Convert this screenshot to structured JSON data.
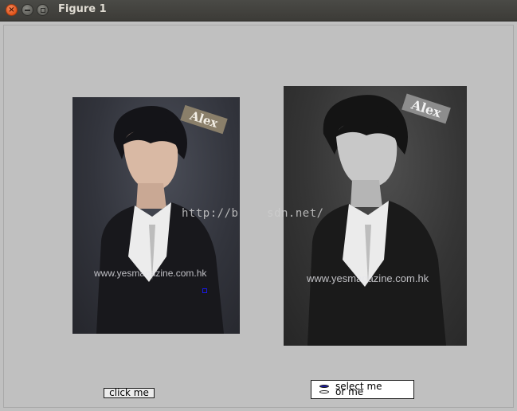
{
  "window": {
    "title": "Figure 1"
  },
  "images": {
    "left": {
      "name_tag": "Alex",
      "watermark": "www.yesmagazine.com.hk"
    },
    "right": {
      "name_tag": "Alex",
      "watermark": "www.yesmagazine.com.hk"
    }
  },
  "overlay_watermark": "http://b    sdn.net/",
  "controls": {
    "button_label": "click me",
    "radio_options": [
      {
        "label": "select me",
        "selected": true
      },
      {
        "label": "or me",
        "selected": false
      }
    ]
  },
  "colors": {
    "canvas_bg": "#c0c0c0",
    "titlebar_bg": "#3c3b37",
    "close_button": "#e0541b",
    "radio_selected": "#1a1aa0"
  }
}
